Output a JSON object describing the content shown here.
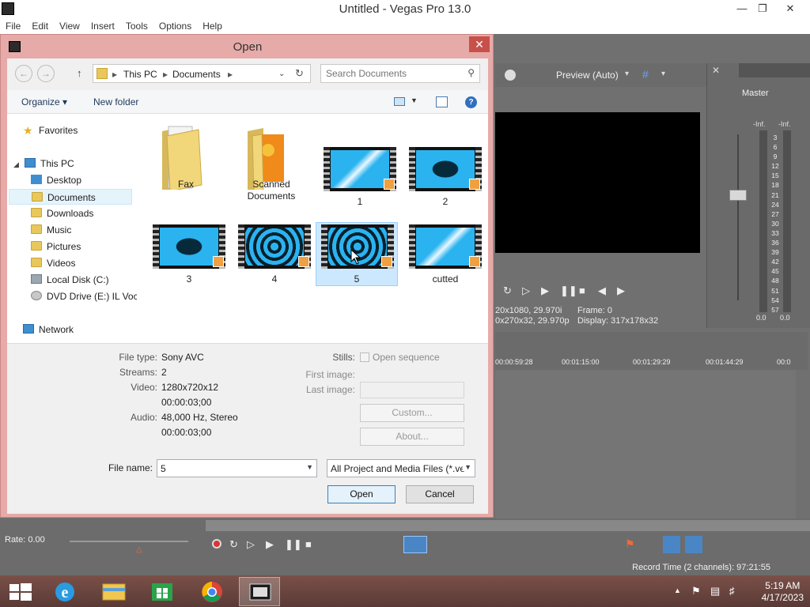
{
  "window": {
    "title": "Untitled - Vegas Pro 13.0",
    "menu": [
      "File",
      "Edit",
      "View",
      "Insert",
      "Tools",
      "Options",
      "Help"
    ]
  },
  "dialog": {
    "title": "Open",
    "address": [
      "This PC",
      "Documents"
    ],
    "search_placeholder": "Search Documents",
    "organize": "Organize ▾",
    "new_folder": "New folder",
    "nav": {
      "favorites": "Favorites",
      "this_pc": "This PC",
      "items": [
        "Desktop",
        "Documents",
        "Downloads",
        "Music",
        "Pictures",
        "Videos",
        "Local Disk (C:)",
        "DVD Drive (E:) IL Voc"
      ],
      "network": "Network"
    },
    "files": [
      {
        "name": "Fax",
        "kind": "folder"
      },
      {
        "name": "Scanned Documents",
        "kind": "folder"
      },
      {
        "name": "1",
        "kind": "video"
      },
      {
        "name": "2",
        "kind": "video"
      },
      {
        "name": "3",
        "kind": "video"
      },
      {
        "name": "4",
        "kind": "video"
      },
      {
        "name": "5",
        "kind": "video"
      },
      {
        "name": "cutted",
        "kind": "video"
      }
    ],
    "details": {
      "file_type_label": "File type:",
      "file_type": "Sony AVC",
      "streams_label": "Streams:",
      "streams": "2",
      "video_label": "Video:",
      "video": "1280x720x12",
      "video_duration": "00:00:03;00",
      "audio_label": "Audio:",
      "audio": "48,000 Hz, Stereo",
      "audio_duration": "00:00:03;00",
      "stills_label": "Stills:",
      "open_sequence": "Open sequence",
      "first_image_label": "First image:",
      "last_image_label": "Last image:",
      "custom": "Custom...",
      "about": "About..."
    },
    "filename_label": "File name:",
    "filename": "5",
    "filetype_filter": "All Project and Media Files (*.ve",
    "open": "Open",
    "cancel": "Cancel"
  },
  "vegas": {
    "preview_label": "Preview (Auto)",
    "master": "Master",
    "info1": "20x1080, 29.970i",
    "info1b": "Frame:  0",
    "info2": "0x270x32, 29.970p",
    "info2b": "Display:  317x178x32",
    "ruler": [
      "00:00:59:28",
      "00:01:15:00",
      "00:01:29:29",
      "00:01:44:29",
      "00:0"
    ],
    "meter_top": [
      "-Inf.",
      "-Inf."
    ],
    "meter_scale": [
      "3",
      "6",
      "9",
      "12",
      "15",
      "18",
      "21",
      "24",
      "27",
      "30",
      "33",
      "36",
      "39",
      "42",
      "45",
      "48",
      "51",
      "54",
      "57"
    ],
    "meter_bottom": [
      "0.0",
      "0.0"
    ],
    "rate": "Rate: 0.00",
    "status": "Record Time (2 channels): 97:21:55"
  },
  "taskbar": {
    "time": "5:19 AM",
    "date": "4/17/2023"
  },
  "colors": {
    "dialog_frame": "#e6aaa8",
    "selection": "#cce8ff",
    "accent": "#29b6f6"
  }
}
